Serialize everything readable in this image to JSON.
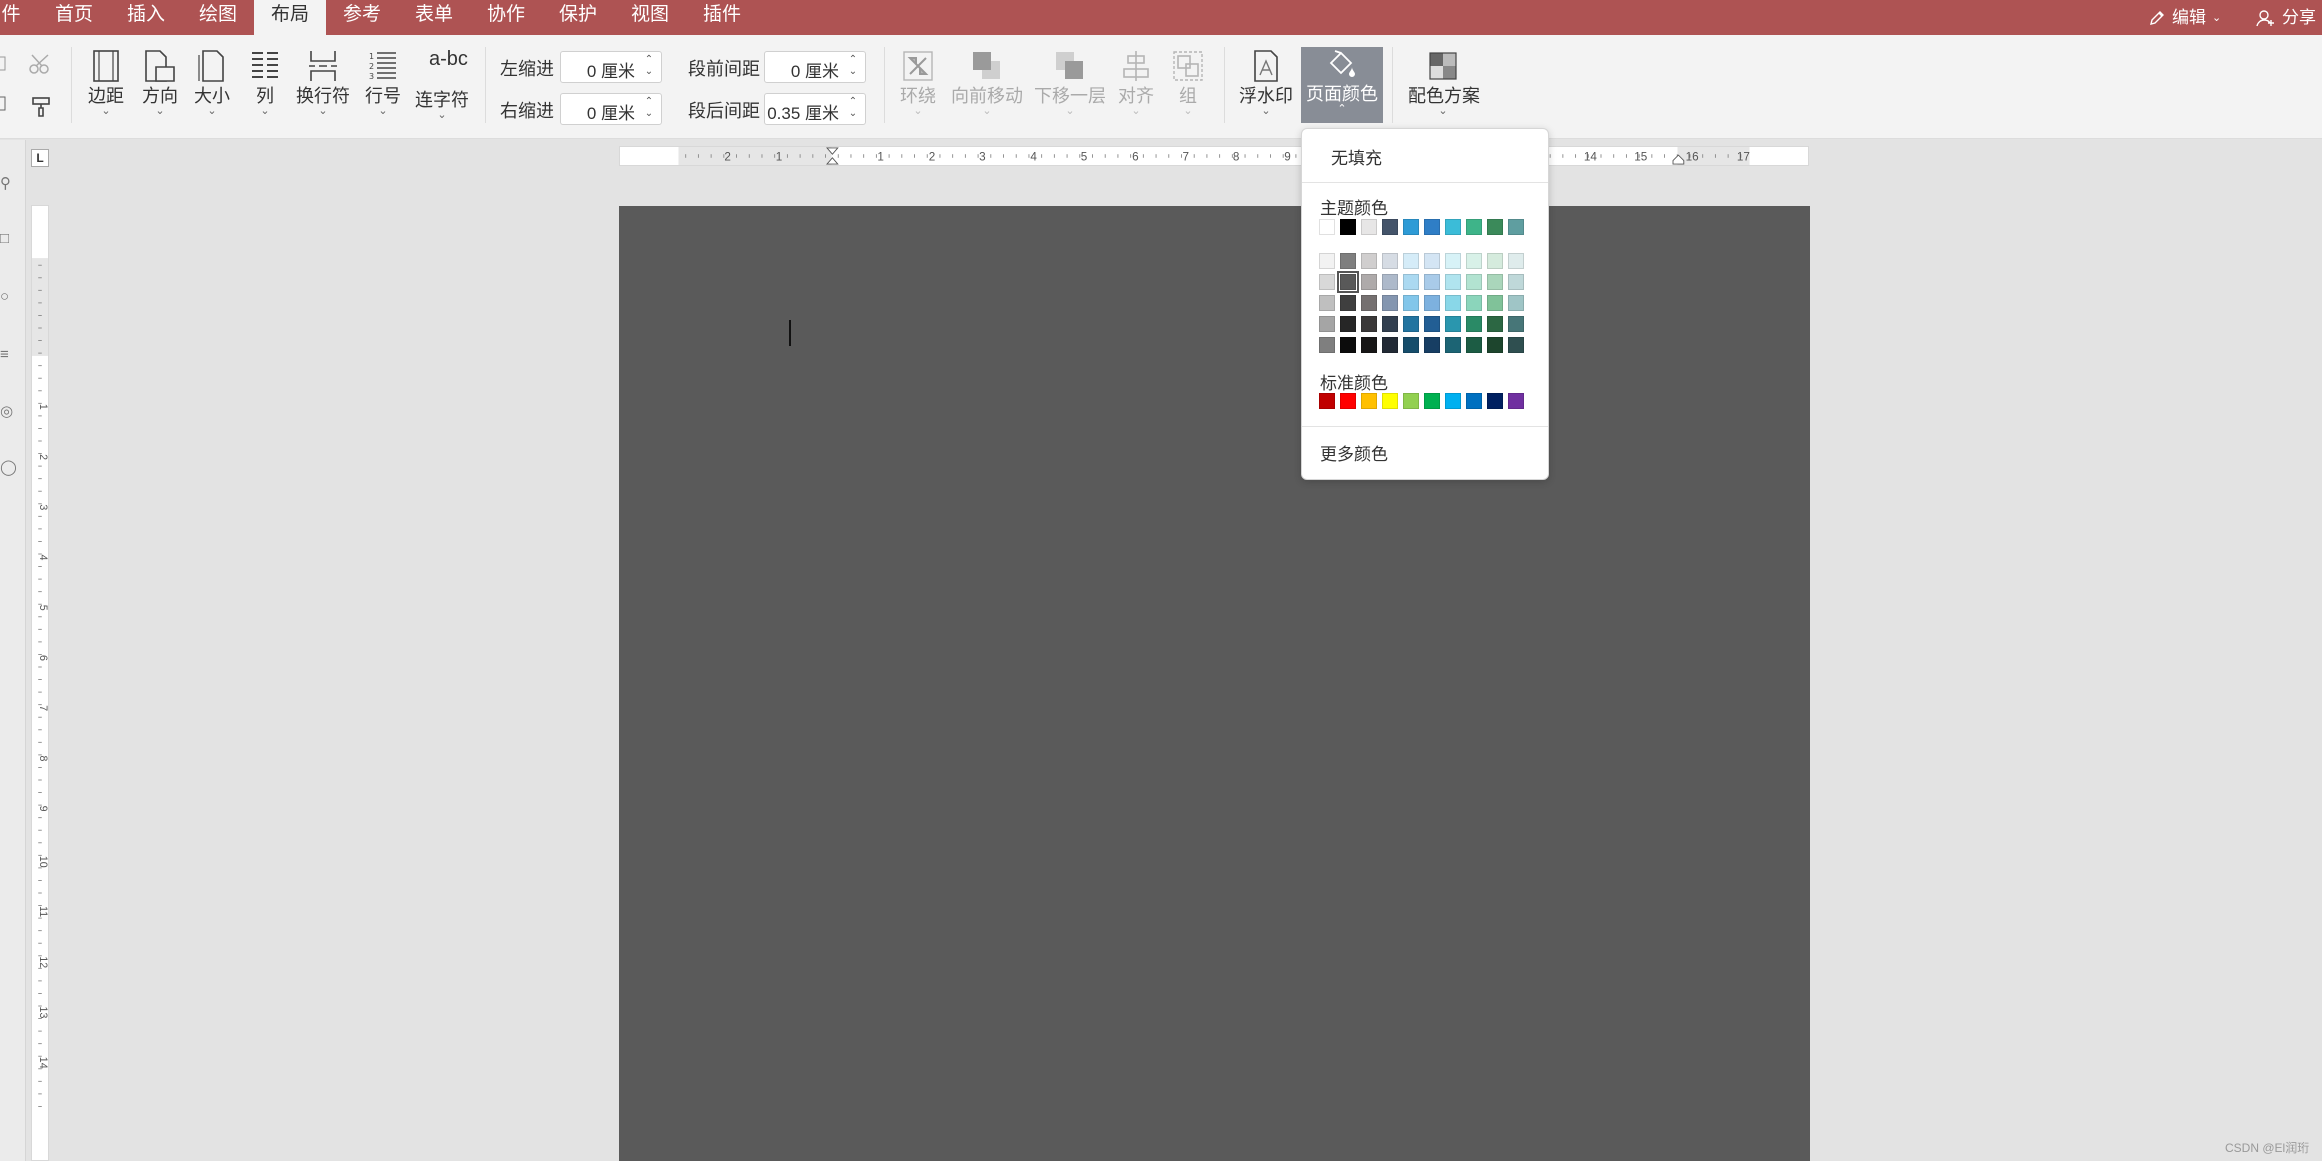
{
  "menu": {
    "tabs": [
      "件",
      "首页",
      "插入",
      "绘图",
      "布局",
      "参考",
      "表单",
      "协作",
      "保护",
      "视图",
      "插件"
    ],
    "active_tab": "布局",
    "edit_label": "编辑",
    "share_label": "分享"
  },
  "ribbon": {
    "margins_label": "边距",
    "orientation_label": "方向",
    "size_label": "大小",
    "columns_label": "列",
    "breaks_label": "换行符",
    "line_numbers_label": "行号",
    "hyphenation_label": "连字符",
    "hyphenation_icon_text": "a-bc",
    "indent_left_label": "左缩进",
    "indent_left_value": "0 厘米",
    "indent_right_label": "右缩进",
    "indent_right_value": "0 厘米",
    "spacing_before_label": "段前间距",
    "spacing_before_value": "0 厘米",
    "spacing_after_label": "段后间距",
    "spacing_after_value": "0.35 厘米",
    "wrap_label": "环绕",
    "bring_forward_label": "向前移动",
    "send_backward_label": "下移一层",
    "align_label": "对齐",
    "group_label": "组",
    "watermark_label": "浮水印",
    "page_color_label": "页面颜色",
    "color_scheme_label": "配色方案"
  },
  "ruler": {
    "h_numbers": [
      "2",
      "1",
      "1",
      "2",
      "3",
      "4",
      "5",
      "6",
      "7",
      "8",
      "9",
      "14",
      "15",
      "16",
      "17"
    ],
    "v_numbers": [
      "1",
      "2",
      "3",
      "4",
      "5",
      "6",
      "7",
      "8",
      "9",
      "10",
      "11",
      "12",
      "13",
      "14"
    ],
    "corner_label": "L"
  },
  "page_color_menu": {
    "no_fill": "无填充",
    "theme_colors_label": "主题颜色",
    "standard_colors_label": "标准颜色",
    "more_colors": "更多颜色",
    "theme_top": [
      "#ffffff",
      "#000000",
      "#e7e6e6",
      "#44546a",
      "#2e9bd6",
      "#2f7ec6",
      "#3bbcd8",
      "#3eb489",
      "#3b8a5a",
      "#5f9ea0"
    ],
    "theme_shades": [
      [
        "#f2f2f2",
        "#7f7f7f",
        "#d0cece",
        "#d6dce4",
        "#d5ecf8",
        "#d4e5f4",
        "#d7f2f7",
        "#d8f1e8",
        "#d5ebdd",
        "#dfecec"
      ],
      [
        "#d8d8d8",
        "#595959",
        "#aeaaaa",
        "#adb9ca",
        "#abd9f1",
        "#a9cbe9",
        "#b0e4ef",
        "#b2e3d1",
        "#aad6bb",
        "#bfd8d9"
      ],
      [
        "#bfbfbf",
        "#3f3f3f",
        "#757070",
        "#8496b0",
        "#82c6ea",
        "#7db1df",
        "#89d7e8",
        "#8bd5bb",
        "#80c299",
        "#9fc5c6"
      ],
      [
        "#a5a5a5",
        "#262626",
        "#3a3838",
        "#323f4f",
        "#2274a0",
        "#225e94",
        "#2a96ae",
        "#2a8a66",
        "#2c6743",
        "#477678"
      ],
      [
        "#7f7f7f",
        "#0c0c0c",
        "#171616",
        "#222a35",
        "#164d6b",
        "#173e63",
        "#1c6474",
        "#1c5c44",
        "#1d452d",
        "#2f4f50"
      ]
    ],
    "standard": [
      "#c00000",
      "#ff0000",
      "#ffc000",
      "#ffff00",
      "#92d050",
      "#00b050",
      "#00b0f0",
      "#0070c0",
      "#002060",
      "#7030a0"
    ],
    "selected_color": "#595959"
  },
  "watermark_text": "CSDN @El润珩"
}
